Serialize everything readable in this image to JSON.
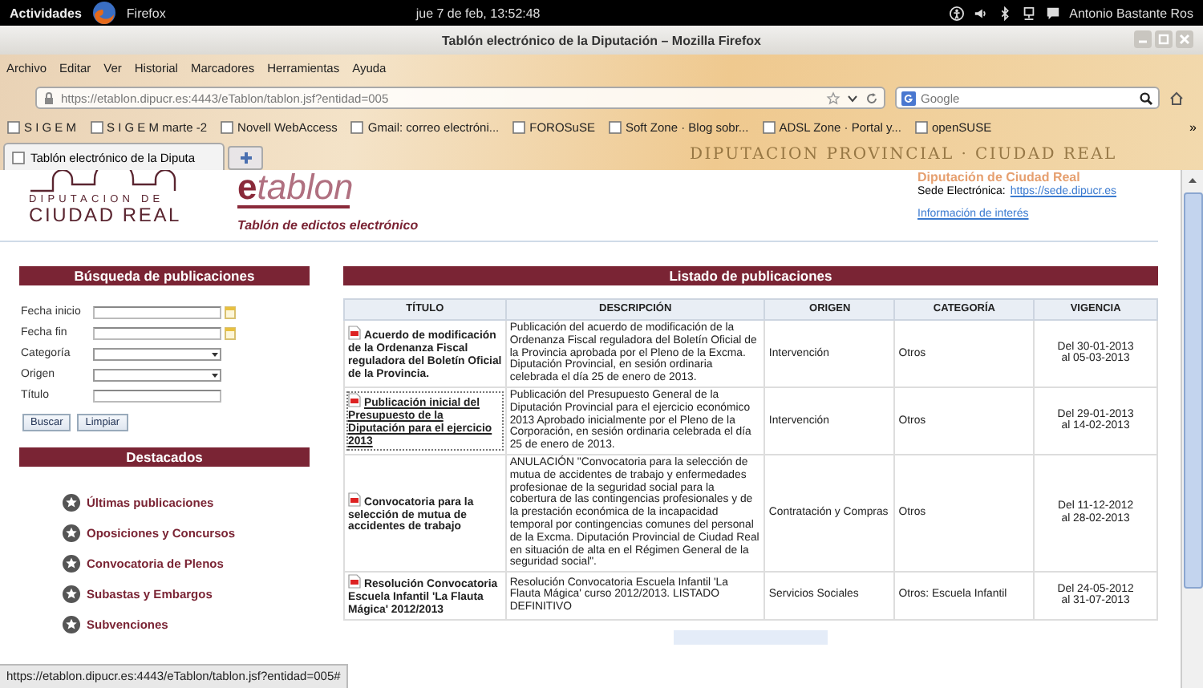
{
  "top_bar": {
    "activities": "Actividades",
    "app": "Firefox",
    "clock": "jue  7 de feb, 13:52:48",
    "user": "Antonio Bastante Ros"
  },
  "window": {
    "title": "Tablón electrónico de la Diputación – Mozilla Firefox"
  },
  "menu": [
    "Archivo",
    "Editar",
    "Ver",
    "Historial",
    "Marcadores",
    "Herramientas",
    "Ayuda"
  ],
  "url_bar": {
    "value": "https://etablon.dipucr.es:4443/eTablon/tablon.jsf?entidad=005"
  },
  "search_field": {
    "placeholder": "Google"
  },
  "bookmarks": [
    {
      "label": "S I G E M"
    },
    {
      "label": "S I G E M marte -2"
    },
    {
      "label": "Novell WebAccess"
    },
    {
      "label": "Gmail: correo electróni..."
    },
    {
      "label": "FOROSuSE"
    },
    {
      "label": "Soft Zone · Blog sobr..."
    },
    {
      "label": "ADSL Zone · Portal y..."
    },
    {
      "label": "openSUSE"
    }
  ],
  "bookmarks_more": "»",
  "theme_banner": "DIPUTACION PROVINCIAL · CIUDAD REAL",
  "tabs": [
    {
      "label": "Tablón electrónico de la Diputa",
      "selected": true
    }
  ],
  "header": {
    "logo_top": "DIPUTACION DE",
    "logo_bottom": "CIUDAD REAL",
    "brand_e": "e",
    "brand_rest": "tablon",
    "subtitle": "Tablón de edictos electrónico",
    "org": "Diputación de Ciudad Real",
    "sede_label": "Sede Electrónica:",
    "sede_link": "https://sede.dipucr.es",
    "info_link": "Información de interés"
  },
  "search_panel": {
    "title": "Búsqueda de publicaciones",
    "fields": [
      {
        "label": "Fecha inicio",
        "kind": "date"
      },
      {
        "label": "Fecha fin",
        "kind": "date"
      },
      {
        "label": "Categoría",
        "kind": "select"
      },
      {
        "label": "Origen",
        "kind": "select"
      },
      {
        "label": "Título",
        "kind": "text"
      }
    ],
    "buttons": [
      "Buscar",
      "Limpiar"
    ]
  },
  "featured": {
    "title": "Destacados",
    "items": [
      "Últimas publicaciones",
      "Oposiciones y Concursos",
      "Convocatoria de Plenos",
      "Subastas y Embargos",
      "Subvenciones"
    ]
  },
  "listing": {
    "title": "Listado de publicaciones",
    "columns": [
      "TÍTULO",
      "DESCRIPCIÓN",
      "ORIGEN",
      "CATEGORÍA",
      "VIGENCIA"
    ],
    "rows": [
      {
        "title": "Acuerdo de modificación de la Ordenanza Fiscal reguladora del Boletín Oficial de la Provincia.",
        "description": "Publicación del acuerdo de modificación de la Ordenanza Fiscal reguladora del Boletín Oficial de la Provincia aprobada por el Pleno de la Excma. Diputación Provincial, en sesión ordinaria celebrada el día 25 de enero de 2013.",
        "origin": "Intervención",
        "category": "Otros",
        "valid_from": "Del 30-01-2013",
        "valid_to": "al 05-03-2013",
        "hovered": false
      },
      {
        "title": "Publicación inicial del Presupuesto de la Diputación para el ejercicio 2013",
        "description": "Publicación del Presupuesto General de la Diputación Provincial para el ejercicio económico 2013 Aprobado inicialmente por el Pleno de la Corporación, en sesión ordinaria celebrada el día 25 de enero de 2013.",
        "origin": "Intervención",
        "category": "Otros",
        "valid_from": "Del 29-01-2013",
        "valid_to": "al 14-02-2013",
        "hovered": true
      },
      {
        "title": "Convocatoria para la selección de mutua de accidentes de trabajo",
        "description": "ANULACIÓN \"Convocatoria para la selección de mutua de accidentes de trabajo y enfermedades profesionae de la seguridad social para la cobertura de las contingencias profesionales y de la prestación económica de la incapacidad temporal por contingencias comunes del personal de la Excma. Diputación Provincial de Ciudad Real en situación de alta en el Régimen General de la seguridad social\".",
        "origin": "Contratación y Compras",
        "category": "Otros",
        "valid_from": "Del 11-12-2012",
        "valid_to": "al 28-02-2013",
        "hovered": false
      },
      {
        "title": "Resolución Convocatoria Escuela Infantil 'La Flauta Mágica' 2012/2013",
        "description": "Resolución Convocatoria Escuela Infantil 'La Flauta Mágica' curso 2012/2013. LISTADO DEFINITIVO",
        "origin": "Servicios Sociales",
        "category": "Otros: Escuela Infantil",
        "valid_from": "Del 24-05-2012",
        "valid_to": "al 31-07-2013",
        "hovered": false
      }
    ]
  },
  "status_bar": "https://etablon.dipucr.es:4443/eTablon/tablon.jsf?entidad=005#"
}
